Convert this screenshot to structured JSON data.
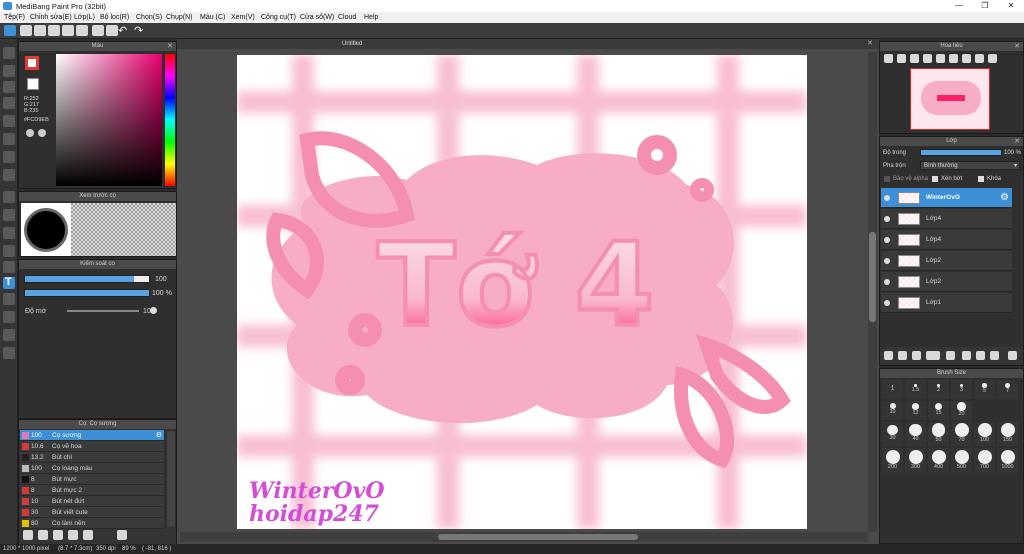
{
  "window": {
    "title": "MediBang Paint Pro (32bit)"
  },
  "menu": [
    "Tệp(F)",
    "Chỉnh sửa(E)",
    "Lớp(L)",
    "Bộ lọc(R)",
    "Chọn(S)",
    "Chụp(N)",
    "Màu (C)",
    "Xem(V)",
    "Công cụ(T)",
    "Cửa sổ(W)",
    "Cloud",
    "Help"
  ],
  "color_panel": {
    "title": "Màu",
    "r": "R:252",
    "g": "G:217",
    "b": "B:235",
    "hex": "#FCD9EB",
    "fg_color": "#FCD9EB"
  },
  "brush_preview": {
    "title": "Xem trước cọ"
  },
  "brush_control": {
    "title": "Kiểm soát cọ",
    "size_value": "100",
    "opacity_value": "100 %",
    "blur_label": "Độ mờ",
    "blur_value": "100",
    "size_fraction": 0.88,
    "opacity_fraction": 1.0,
    "blur_fraction": 1.0
  },
  "brush_list": {
    "title": "Cọ: Cọ sương",
    "items": [
      {
        "size": "100",
        "name": "Cọ sương",
        "color": "#e07ab3",
        "selected": true
      },
      {
        "size": "10.6",
        "name": "Cọ vẽ hoa",
        "color": "#d13a3a",
        "selected": false
      },
      {
        "size": "13.2",
        "name": "Bút chì",
        "color": "#222222",
        "selected": false
      },
      {
        "size": "100",
        "name": "Cọ loang màu",
        "color": "#bbbbbb",
        "selected": false
      },
      {
        "size": "8",
        "name": "Bút mực",
        "color": "#111111",
        "selected": false
      },
      {
        "size": "8",
        "name": "Bút mực 2",
        "color": "#d13a3a",
        "selected": false
      },
      {
        "size": "10",
        "name": "Bút nét đứt",
        "color": "#d13a3a",
        "selected": false
      },
      {
        "size": "30",
        "name": "Bút viết cute",
        "color": "#d13a3a",
        "selected": false
      },
      {
        "size": "80",
        "name": "Cọ làm nền",
        "color": "#e0c000",
        "selected": false
      }
    ]
  },
  "document": {
    "tab": "Untitled"
  },
  "artwork": {
    "title_text": "Tớ 4",
    "watermark_line1": "WinterOvO",
    "watermark_line2": "hoidap247"
  },
  "navigator": {
    "title": "Hoa tiêu"
  },
  "layers": {
    "title": "Lớp",
    "opacity_label": "Độ trong",
    "opacity_value": "100 %",
    "opacity_fraction": 1.0,
    "blend_label": "Pha trộn",
    "blend_value": "Bình thường",
    "protect_alpha": "Bảo vệ alpha",
    "clipping": "Xén bớt",
    "lock": "Khóa",
    "items": [
      {
        "name": "WinterOvO",
        "selected": true
      },
      {
        "name": "Lớp4",
        "selected": false
      },
      {
        "name": "Lớp4",
        "selected": false
      },
      {
        "name": "Lớp2",
        "selected": false
      },
      {
        "name": "Lớp2",
        "selected": false
      },
      {
        "name": "Lớp1",
        "selected": false
      }
    ]
  },
  "brush_size": {
    "title": "Brush Size",
    "sizes": [
      "1",
      "1.5",
      "2",
      "3",
      "5",
      "7",
      "10",
      "12",
      "15",
      "20",
      "30",
      "40",
      "50",
      "70",
      "100",
      "150",
      "200",
      "300",
      "400",
      "500",
      "700",
      "1000"
    ]
  },
  "status": {
    "dimensions": "1200 * 1000 pixel",
    "physical": "(8.7 * 7.3cm)",
    "dpi": "350 dpi",
    "zoom": "89 %",
    "coords": "( -81, 816 )"
  }
}
